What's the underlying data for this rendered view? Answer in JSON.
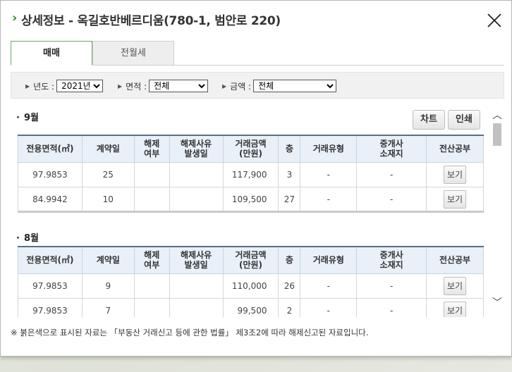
{
  "window": {
    "title": "상세정보 - 옥길호반베르디움(780-1, 범안로 220)",
    "title_mark": "›"
  },
  "tabs": [
    {
      "label": "매매",
      "active": true
    },
    {
      "label": "전월세",
      "active": false
    }
  ],
  "filters": {
    "year": {
      "label": "년도 :",
      "value": "2021년"
    },
    "area": {
      "label": "면적 :",
      "value": "전체"
    },
    "amount": {
      "label": "금액 :",
      "value": "전체"
    }
  },
  "actions": {
    "chart_label": "차트",
    "print_label": "인쇄"
  },
  "columns": [
    "전용면적(㎡)",
    "계약일",
    "해제\n여부",
    "해제사유\n발생일",
    "거래금액\n(만원)",
    "층",
    "거래유형",
    "중개사\n소재지",
    "전산공부"
  ],
  "sections": [
    {
      "title": "9월",
      "rows": [
        {
          "area": "97.9853",
          "day": "25",
          "cancel": "",
          "cancel_date": "",
          "price": "117,900",
          "floor": "3",
          "type": "-",
          "broker": "-",
          "view": "보기"
        },
        {
          "area": "84.9942",
          "day": "10",
          "cancel": "",
          "cancel_date": "",
          "price": "109,500",
          "floor": "27",
          "type": "-",
          "broker": "-",
          "view": "보기"
        }
      ]
    },
    {
      "title": "8월",
      "rows": [
        {
          "area": "97.9853",
          "day": "9",
          "cancel": "",
          "cancel_date": "",
          "price": "110,000",
          "floor": "26",
          "type": "-",
          "broker": "-",
          "view": "보기"
        },
        {
          "area": "97.9853",
          "day": "7",
          "cancel": "",
          "cancel_date": "",
          "price": "99,500",
          "floor": "2",
          "type": "-",
          "broker": "-",
          "view": "보기"
        }
      ]
    }
  ],
  "footnote": "※ 붉은색으로 표시된 자료는 「부동산 거래신고 등에 관한 법률」 제3조2에 따라 해제신고된 자료입니다.",
  "icons": {
    "close": "close-icon",
    "dropdown": "chevron-down-icon",
    "scroll_up": "chevron-up-icon",
    "scroll_down": "chevron-down-icon"
  },
  "colors": {
    "accent": "#2f8a2f",
    "header_bg": "#e9f0f8",
    "table_top": "#5c6e82"
  }
}
